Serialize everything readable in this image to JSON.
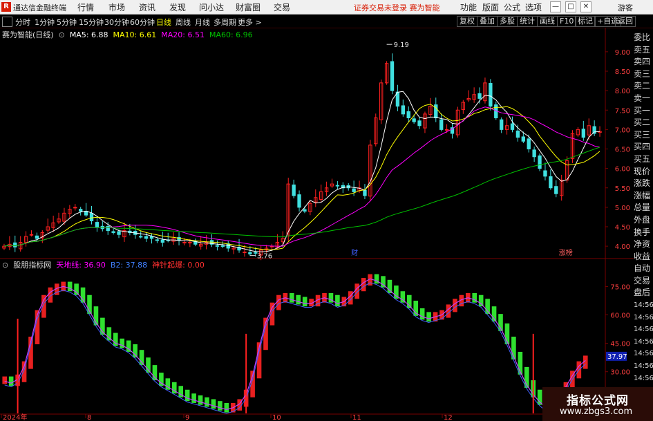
{
  "app": {
    "logo": "R",
    "title": "通达信金融终端",
    "menu": [
      "行情",
      "市场",
      "资讯",
      "发现",
      "问小达",
      "财富圈",
      "交易"
    ],
    "warning": "证券交易未登录  赛为智能",
    "right_menu": [
      "功能",
      "版面",
      "公式",
      "选项"
    ],
    "guest": "游客",
    "win_min": "—",
    "win_max": "□",
    "win_close": "✕"
  },
  "periodbar": {
    "periods": [
      "分时",
      "1分钟",
      "5分钟",
      "15分钟",
      "30分钟",
      "60分钟",
      "日线",
      "周线",
      "月线",
      "多周期",
      "更多 >"
    ],
    "active": "日线",
    "tools": [
      "复权",
      "叠加",
      "多股",
      "统计",
      "画线",
      "F10",
      "标记",
      "+自选",
      "返回"
    ]
  },
  "main_legend": {
    "title": "赛为智能(日线)",
    "ma5": "MA5: 6.88",
    "ma10": "MA10: 6.61",
    "ma20": "MA20: 6.51",
    "ma60": "MA60: 6.96"
  },
  "annotations": {
    "high": "9.19",
    "low": "3.76",
    "marker1": "财",
    "marker2": "涨榜"
  },
  "sub_legend": {
    "title": "股朋指标网",
    "tiandi": "天地线: 36.90",
    "b2": "B2: 37.88",
    "shenzhen": "神针起爆: 0.00",
    "current_value": "37.97"
  },
  "date_labels": [
    "2024年",
    "8",
    "9",
    "10",
    "11",
    "12"
  ],
  "price_ticks": [
    "9.00",
    "8.50",
    "8.00",
    "7.50",
    "7.00",
    "6.50",
    "6.00",
    "5.50",
    "5.00",
    "4.50",
    "4.00"
  ],
  "sub_ticks": [
    "75.00",
    "60.00",
    "45.00",
    "30.00",
    "15.00"
  ],
  "right_panel": [
    "委比",
    "卖五",
    "卖四",
    "卖三",
    "卖二",
    "卖一",
    "买一",
    "买二",
    "买三",
    "买四",
    "买五",
    "现价",
    "涨跌",
    "涨幅",
    "总量",
    "外盘",
    "换手",
    "净资",
    "收益",
    "自动",
    "交易",
    "盘后",
    "14:56",
    "14:56",
    "14:56",
    "14:56",
    "14:56",
    "14:56",
    "14:56",
    "14:56"
  ],
  "watermark": {
    "line1": "指标公式网",
    "line2": "www.zbgs3.com"
  },
  "colors": {
    "up": "#ff2020",
    "down": "#40e0e0",
    "sub_up": "#e82020",
    "sub_down": "#30e030",
    "ma5": "#ffffff",
    "ma10": "#ffff00",
    "ma20": "#ff00ff",
    "ma60": "#00c000",
    "axis": "#7a0000"
  },
  "chart_data": {
    "type": "candlestick",
    "price_ylim": [
      3.7,
      9.3
    ],
    "closes": [
      4.0,
      4.05,
      3.98,
      4.1,
      4.25,
      4.3,
      4.2,
      4.35,
      4.5,
      4.6,
      4.7,
      4.85,
      4.95,
      5.0,
      4.9,
      4.8,
      4.65,
      4.5,
      4.45,
      4.4,
      4.35,
      4.3,
      4.4,
      4.35,
      4.3,
      4.25,
      4.2,
      4.2,
      4.15,
      4.1,
      4.15,
      4.2,
      4.15,
      4.1,
      4.1,
      4.05,
      4.05,
      4.1,
      4.05,
      4.0,
      4.0,
      3.95,
      3.95,
      3.9,
      3.85,
      3.8,
      3.82,
      3.9,
      3.95,
      4.0,
      4.1,
      4.2,
      5.6,
      5.3,
      5.0,
      4.9,
      5.1,
      5.25,
      5.4,
      5.5,
      5.6,
      5.55,
      5.5,
      5.5,
      5.4,
      5.5,
      5.3,
      6.6,
      7.3,
      8.2,
      8.7,
      8.0,
      7.6,
      7.4,
      7.3,
      7.2,
      7.1,
      7.4,
      7.6,
      7.3,
      7.0,
      7.0,
      6.9,
      7.5,
      7.7,
      7.8,
      7.9,
      7.8,
      8.2,
      7.6,
      7.3,
      7.0,
      7.1,
      7.0,
      6.8,
      6.7,
      6.5,
      6.3,
      6.0,
      5.8,
      5.5,
      5.35,
      5.7,
      6.2,
      6.9,
      7.0,
      6.8,
      7.1,
      6.9,
      6.95
    ],
    "ma_values": {
      "MA5": 6.88,
      "MA10": 6.61,
      "MA20": 6.51,
      "MA60": 6.96
    },
    "high_label": 9.19,
    "low_label": 3.76,
    "sub_ylim": [
      8,
      85
    ],
    "sub_values": [
      27,
      26,
      28,
      35,
      48,
      62,
      70,
      74,
      76,
      77,
      76,
      74,
      70,
      64,
      58,
      53,
      50,
      47,
      46,
      44,
      41,
      37,
      33,
      29,
      26,
      24,
      22,
      20,
      18,
      17,
      16,
      15,
      14,
      13,
      12,
      13,
      15,
      20,
      30,
      45,
      58,
      66,
      70,
      71,
      70,
      69,
      68,
      68,
      70,
      71,
      70,
      68,
      69,
      72,
      76,
      79,
      81,
      80,
      78,
      75,
      72,
      70,
      67,
      63,
      61,
      60,
      61,
      62,
      65,
      68,
      70,
      71,
      70,
      68,
      64,
      60,
      55,
      48,
      40,
      32,
      25,
      20,
      16,
      13,
      14,
      18,
      24,
      30,
      35,
      38
    ],
    "sub_spikes": [
      2,
      37,
      81
    ],
    "sub_current": 37.97
  }
}
